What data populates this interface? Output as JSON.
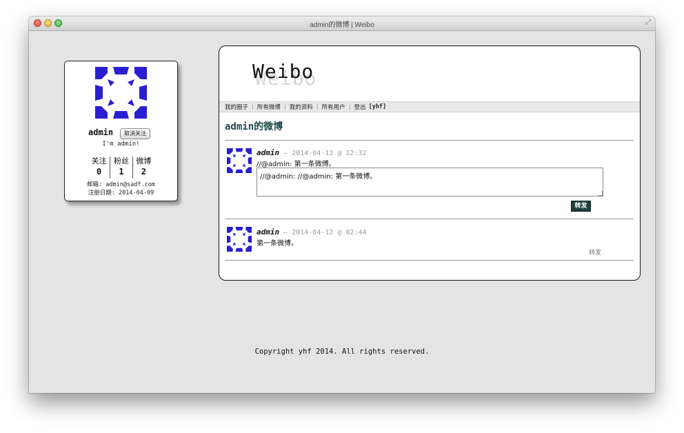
{
  "window": {
    "title": "admin的微博 | Weibo"
  },
  "profile": {
    "name": "admin",
    "unfollow_label": "取消关注",
    "bio": "I'm admin!",
    "stats": [
      {
        "label": "关注",
        "value": "0"
      },
      {
        "label": "粉丝",
        "value": "1"
      },
      {
        "label": "微博",
        "value": "2"
      }
    ],
    "email": "邮箱: admin@sadf.com",
    "reg_date": "注册日期: 2014-04-09"
  },
  "site": {
    "logo": "Weibo"
  },
  "nav": {
    "items": [
      "我的圈子",
      "所有微博",
      "我的资料",
      "所有用户",
      "登出"
    ],
    "user": "[yhf]"
  },
  "page_title": "admin的微博",
  "posts": [
    {
      "author": "admin",
      "timestamp": "– 2014-04-12 @ 12:32",
      "text": "//@admin: 第一条微博。",
      "repost_value": "//@admin: //@admin: 第一条微博。",
      "repost_button": "转发"
    },
    {
      "author": "admin",
      "timestamp": "– 2014-04-12 @ 02:44",
      "text": "第一条微博。",
      "repost_link": "转发"
    }
  ],
  "footer": "Copyright yhf 2014. All rights reserved.",
  "colors": {
    "avatar": "#2a1fd0",
    "title": "#1f4a4a",
    "button": "#1e3f3f"
  }
}
